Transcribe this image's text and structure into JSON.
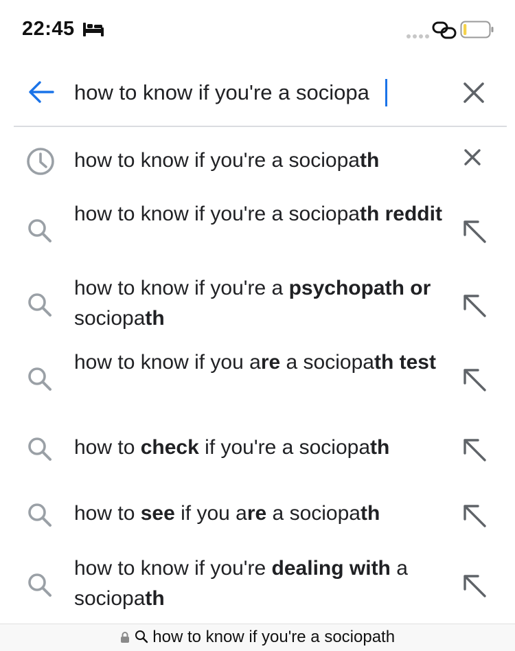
{
  "status_bar": {
    "time": "22:45",
    "icons": [
      "bed-icon",
      "signal-dots-icon",
      "link-icon",
      "battery-icon"
    ],
    "battery_level": 0.12,
    "battery_color": "#f5d24b"
  },
  "search": {
    "value": "how to know if you're a sociopa",
    "icons": [
      "back-arrow-icon",
      "clear-icon"
    ],
    "accent_color": "#1a73e8"
  },
  "suggestions": [
    {
      "type": "history",
      "icon": "history-clock-icon",
      "action_icon": "remove-icon",
      "parts": [
        {
          "t": "how to know if you're a sociopa",
          "b": false
        },
        {
          "t": "th",
          "b": true
        }
      ]
    },
    {
      "type": "search",
      "icon": "search-icon",
      "action_icon": "fill-arrow-icon",
      "parts": [
        {
          "t": "how to know if you're a sociopa",
          "b": false
        },
        {
          "t": "th reddit",
          "b": true
        }
      ]
    },
    {
      "type": "search",
      "icon": "search-icon",
      "action_icon": "fill-arrow-icon",
      "parts": [
        {
          "t": "how to know if you're a ",
          "b": false
        },
        {
          "t": "psychopath or",
          "b": true
        },
        {
          "t": " sociopa",
          "b": false
        },
        {
          "t": "th",
          "b": true
        }
      ]
    },
    {
      "type": "search",
      "icon": "search-icon",
      "action_icon": "fill-arrow-icon",
      "parts": [
        {
          "t": "how to know if you a",
          "b": false
        },
        {
          "t": "re",
          "b": true
        },
        {
          "t": " a sociopa",
          "b": false
        },
        {
          "t": "th test",
          "b": true
        }
      ]
    },
    {
      "type": "search",
      "icon": "search-icon",
      "action_icon": "fill-arrow-icon",
      "parts": [
        {
          "t": "how to ",
          "b": false
        },
        {
          "t": "check",
          "b": true
        },
        {
          "t": " if you're a sociopa",
          "b": false
        },
        {
          "t": "th",
          "b": true
        }
      ]
    },
    {
      "type": "search",
      "icon": "search-icon",
      "action_icon": "fill-arrow-icon",
      "parts": [
        {
          "t": "how to ",
          "b": false
        },
        {
          "t": "see",
          "b": true
        },
        {
          "t": " if you a",
          "b": false
        },
        {
          "t": "re",
          "b": true
        },
        {
          "t": " a sociopa",
          "b": false
        },
        {
          "t": "th",
          "b": true
        }
      ]
    },
    {
      "type": "search",
      "icon": "search-icon",
      "action_icon": "fill-arrow-icon",
      "parts": [
        {
          "t": "how to know if you're ",
          "b": false
        },
        {
          "t": "dealing with",
          "b": true
        },
        {
          "t": " a sociopa",
          "b": false
        },
        {
          "t": "th",
          "b": true
        }
      ]
    }
  ],
  "bottom_bar": {
    "url_text": "how to know if you're a sociopath",
    "icons": [
      "lock-icon",
      "search-icon"
    ]
  }
}
